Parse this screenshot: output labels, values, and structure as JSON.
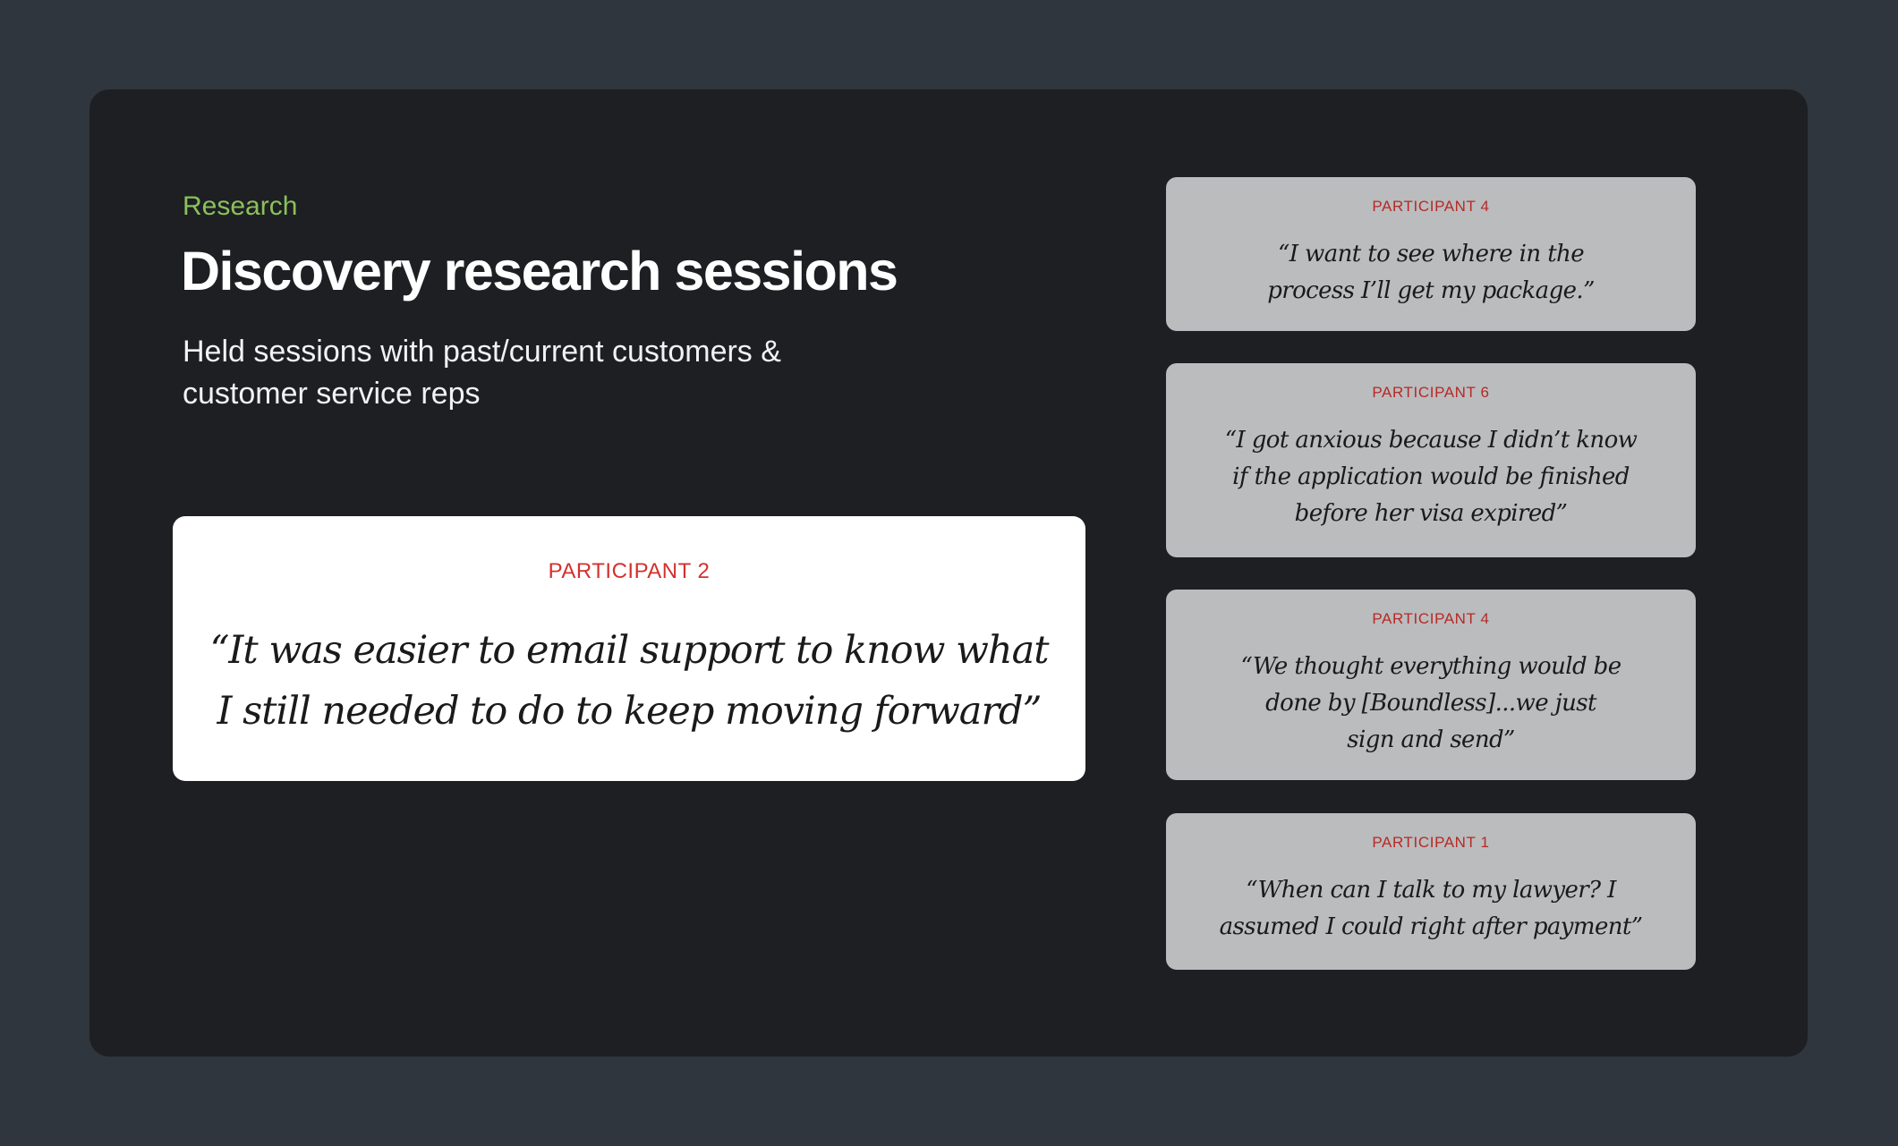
{
  "slide": {
    "eyebrow": "Research",
    "title": "Discovery research sessions",
    "subtitle": "Held sessions with past/current customers & customer service reps"
  },
  "featured_quote": {
    "participant": "PARTICIPANT 2",
    "quote": "“It was easier to email support to know what I still needed to do to keep moving forward”"
  },
  "quotes": [
    {
      "participant": "PARTICIPANT 4",
      "quote": "“I want to see where in the process I’ll get my package.”"
    },
    {
      "participant": "PARTICIPANT 6",
      "quote": "“I got anxious because I didn’t know if the application would be finished before her visa expired”"
    },
    {
      "participant": "PARTICIPANT 4",
      "quote": "“We thought everything would be done by [Boundless]...we just sign and send”"
    },
    {
      "participant": "PARTICIPANT 1",
      "quote": "“When can I talk to my lawyer? I assumed I could right after payment”"
    }
  ],
  "colors": {
    "page_background": "#2f363d",
    "slide_background": "#1d1f23",
    "eyebrow": "#8cc05a",
    "participant_label": "#d4312d",
    "quote_card": "#bbbcbe"
  }
}
